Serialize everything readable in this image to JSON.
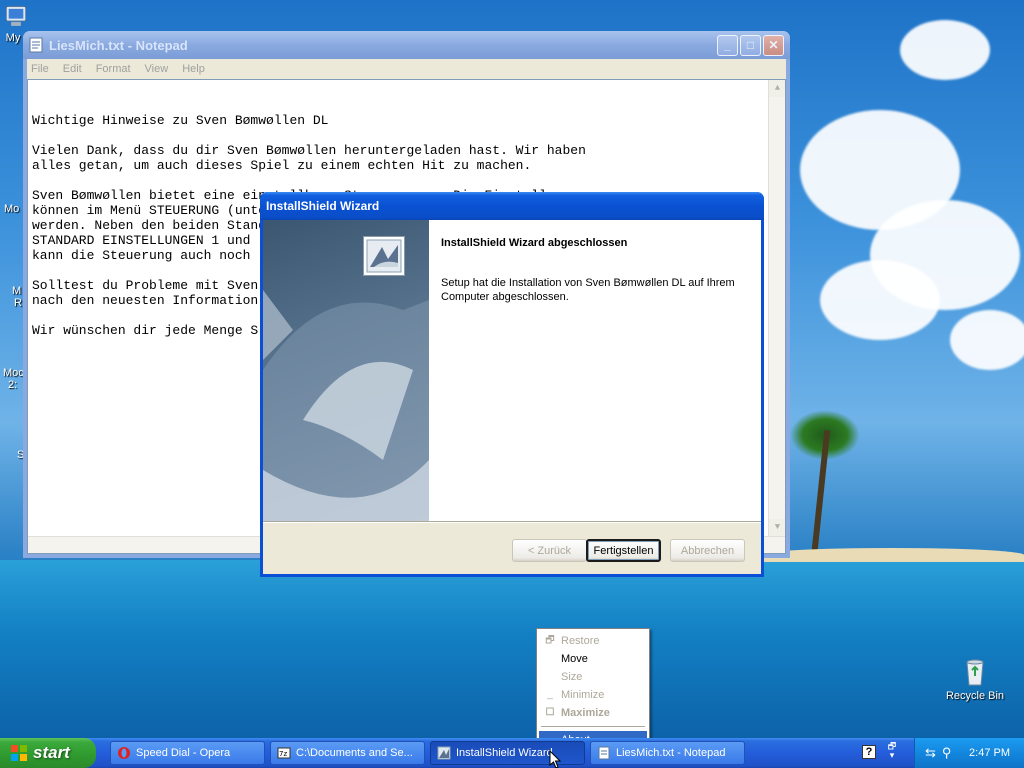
{
  "desktop": {
    "icons": [
      {
        "label": "My"
      },
      {
        "label": "Mo"
      },
      {
        "label": "M"
      },
      {
        "label": "R"
      },
      {
        "label": "Moc"
      },
      {
        "label": "2:"
      },
      {
        "label": "S"
      }
    ],
    "recycle_bin": "Recycle Bin"
  },
  "notepad": {
    "title": "LiesMich.txt - Notepad",
    "menu": [
      "File",
      "Edit",
      "Format",
      "View",
      "Help"
    ],
    "content": "Wichtige Hinweise zu Sven Bømwøllen DL\n\nVielen Dank, dass du dir Sven Bømwøllen heruntergeladen hast. Wir haben\nalles getan, um auch dieses Spiel zu einem echten Hit zu machen.\n\nSven Bømwøllen bietet eine einstellbare Steuerung an. Die Einstellungen\nkönnen im Menü STEUERUNG (unterhalb von HILFE im Hauptmenü) verändert\nwerden. Neben den beiden Stand\nSTANDARD EINSTELLUNGEN 1 und\nkann die Steuerung auch noch\n\nSolltest du Probleme mit Sven\nnach den neuesten Information\n\nWir wünschen dir jede Menge S"
  },
  "wizard": {
    "title": "InstallShield Wizard",
    "heading": "InstallShield Wizard abgeschlossen",
    "text": "Setup hat die Installation von Sven Bømwøllen DL auf Ihrem Computer abgeschlossen.",
    "buttons": {
      "back": "< Zurück",
      "finish": "Fertigstellen",
      "cancel": "Abbrechen"
    }
  },
  "context_menu": {
    "items": [
      {
        "label": "Restore",
        "state": "disabled"
      },
      {
        "label": "Move",
        "state": "enabled"
      },
      {
        "label": "Size",
        "state": "disabled"
      },
      {
        "label": "Minimize",
        "state": "disabled"
      },
      {
        "label": "Maximize",
        "state": "disabled"
      },
      {
        "label": "About...",
        "state": "selected"
      }
    ]
  },
  "taskbar": {
    "start": "start",
    "tasks": [
      {
        "label": "Speed Dial - Opera"
      },
      {
        "label": "C:\\Documents and Se..."
      },
      {
        "label": "InstallShield Wizard"
      },
      {
        "label": "LiesMich.txt - Notepad"
      }
    ],
    "clock": "2:47 PM"
  },
  "colors": {
    "xp_blue": "#0a50d0",
    "start_green": "#3aa83a",
    "menu_highlight": "#316ac5"
  }
}
